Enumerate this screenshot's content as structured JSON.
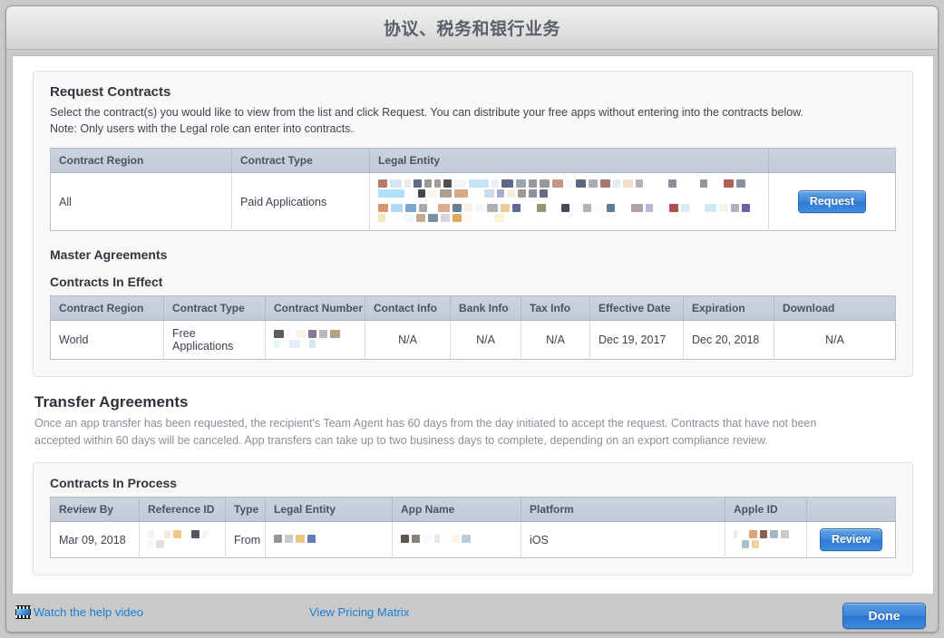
{
  "window": {
    "title": "协议、税务和银行业务"
  },
  "request_contracts": {
    "heading": "Request Contracts",
    "description_line1": "Select the contract(s) you would like to view from the list and click Request. You can distribute your free apps without entering into the contracts below.",
    "description_line2": "Note: Only users with the Legal role can enter into contracts.",
    "table": {
      "headers": [
        "Contract Region",
        "Contract Type",
        "Legal Entity",
        ""
      ],
      "row": {
        "contract_region": "All",
        "contract_type": "Paid Applications",
        "legal_entity": "",
        "action_label": "Request"
      }
    }
  },
  "master_agreements": {
    "heading": "Master Agreements",
    "subheading": "Contracts In Effect",
    "table": {
      "headers": [
        "Contract Region",
        "Contract Type",
        "Contract Number",
        "Contact Info",
        "Bank Info",
        "Tax Info",
        "Effective Date",
        "Expiration",
        "Download"
      ],
      "rows": [
        {
          "contract_region": "World",
          "contract_type": "Free Applications",
          "contract_number": "",
          "contact_info": "N/A",
          "bank_info": "N/A",
          "tax_info": "N/A",
          "effective_date": "Dec 19, 2017",
          "expiration": "Dec 20, 2018",
          "download": "N/A"
        }
      ]
    }
  },
  "transfer_agreements": {
    "heading": "Transfer Agreements",
    "description_line1": "Once an app transfer has been requested, the recipient's Team Agent has 60 days from the day initiated to accept the request. Contracts that have not been",
    "description_line2": "accepted within 60 days will be canceled. App transfers can take up to two business days to complete, depending on an export compliance review.",
    "subheading": "Contracts In Process",
    "table": {
      "headers": [
        "Review By",
        "Reference ID",
        "Type",
        "Legal Entity",
        "App Name",
        "Platform",
        "Apple ID",
        ""
      ],
      "rows": [
        {
          "review_by": "Mar 09, 2018",
          "reference_id": "",
          "type": "From",
          "legal_entity": "",
          "app_name": "",
          "platform": "iOS",
          "apple_id": "",
          "action_label": "Review"
        }
      ]
    }
  },
  "footer": {
    "help_video_link": "Watch the help video",
    "help_video_icon": "film-strip-icon",
    "pricing_matrix_link": "View Pricing Matrix",
    "done_label": "Done"
  },
  "colors": {
    "accent_blue": "#1a7fd4",
    "button_blue": "#3d86dc",
    "table_header": "#c5ccd8",
    "title_text": "#59616c"
  }
}
